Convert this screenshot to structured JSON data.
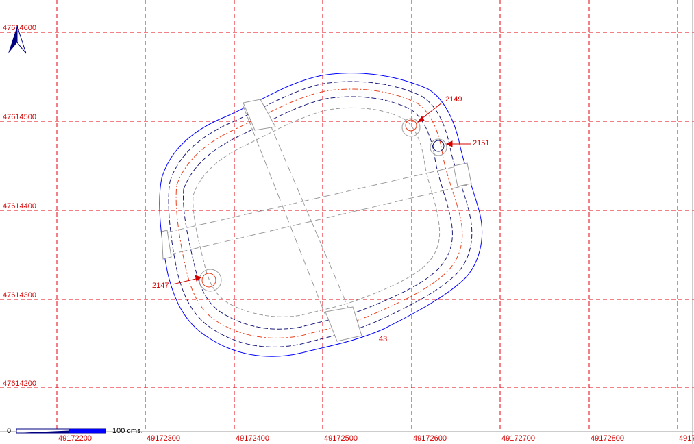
{
  "colors": {
    "grid": "#e3000f",
    "blue_outline": "#0000ff",
    "red_contour": "#e8401c",
    "dark_contour": "#1a1a7a",
    "gray_guides": "#9a9a9a",
    "label_red": "#d40000",
    "arrow": "#000080"
  },
  "grid": {
    "x_labels": [
      "49172200",
      "49172300",
      "49172400",
      "49172500",
      "49172600",
      "49172700",
      "49172800",
      "4917"
    ],
    "y_labels": [
      "47614600",
      "47614500",
      "47614400",
      "47614300",
      "47614200"
    ]
  },
  "features": {
    "points": [
      {
        "id": "2149",
        "label": "2149"
      },
      {
        "id": "2151",
        "label": "2151"
      },
      {
        "id": "2147",
        "label": "2147"
      }
    ],
    "structure_label": "43"
  },
  "scale_bar": {
    "start_label": "0",
    "end_label": "100 cms."
  },
  "north_arrow": {
    "icon": "north-arrow-icon"
  }
}
